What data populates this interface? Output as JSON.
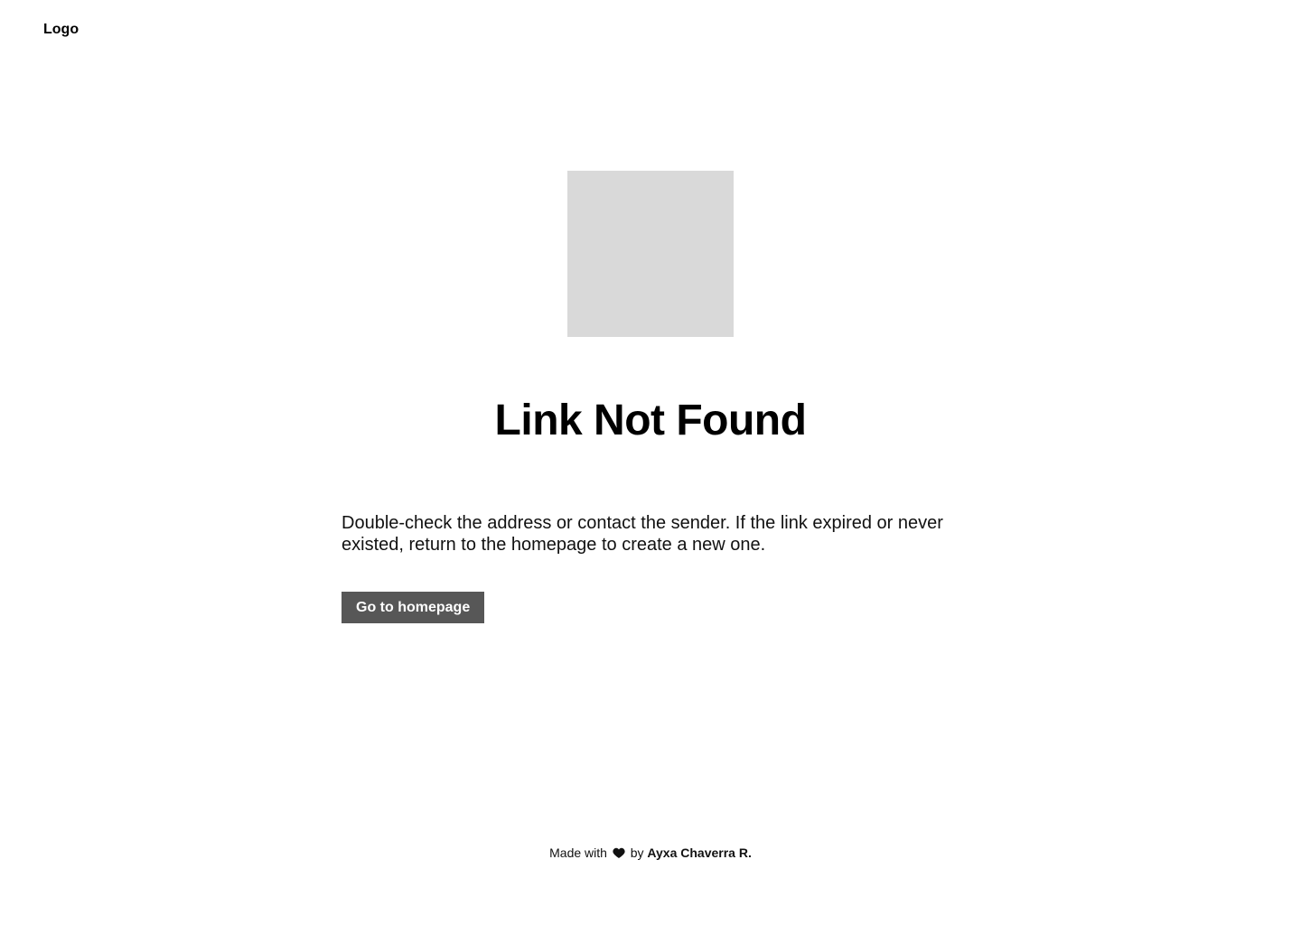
{
  "header": {
    "logo_text": "Logo"
  },
  "main": {
    "title": "Link Not Found",
    "description": "Double-check the address or contact the sender. If the link expired or never existed, return to the homepage to create a new one.",
    "cta_label": "Go to homepage"
  },
  "footer": {
    "made_with": "Made with",
    "by": "by",
    "author": "Ayxa Chaverra R.",
    "heart_icon": "heart-icon"
  },
  "colors": {
    "placeholder": "#d9d9d9",
    "button_bg": "#575757",
    "button_text": "#ffffff",
    "text": "#000000"
  }
}
